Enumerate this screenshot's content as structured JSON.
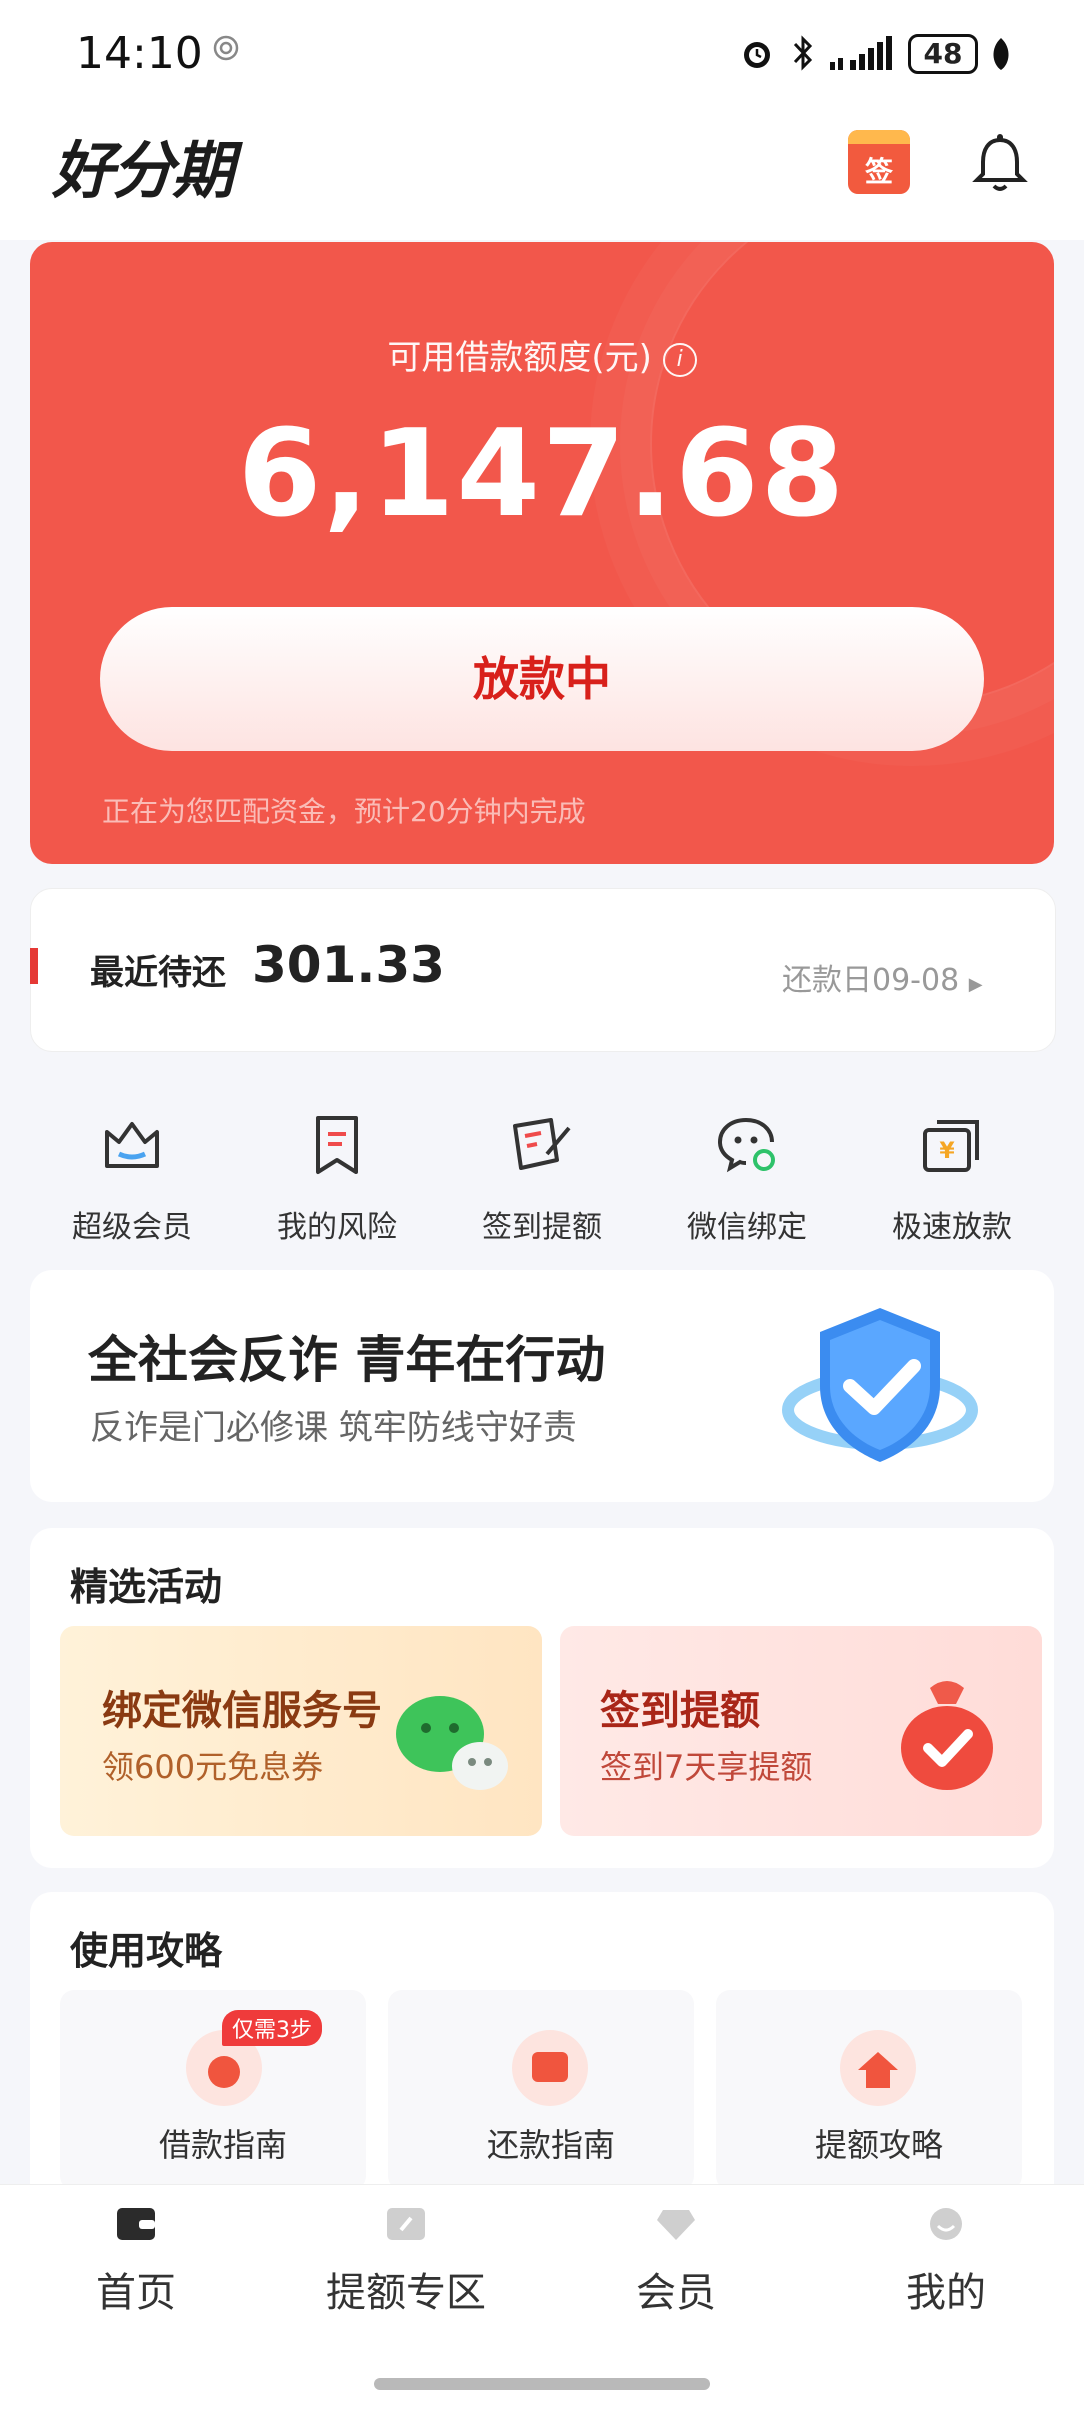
{
  "status_bar": {
    "time": "14:10",
    "battery": "48"
  },
  "header": {
    "logo": "好分期",
    "sign_icon_text": "签"
  },
  "credit": {
    "label": "可用借款额度(元)",
    "amount": "6,147.68",
    "status_button": "放款中",
    "note": "正在为您匹配资金，预计20分钟内完成"
  },
  "repay": {
    "label": "最近待还",
    "amount": "301.33",
    "date": "还款日09-08"
  },
  "quick_actions": [
    {
      "label": "超级会员",
      "icon": "crown-icon"
    },
    {
      "label": "我的风险",
      "icon": "bookmark-icon"
    },
    {
      "label": "签到提额",
      "icon": "sign-pen-icon"
    },
    {
      "label": "微信绑定",
      "icon": "wechat-icon"
    },
    {
      "label": "极速放款",
      "icon": "yuan-card-icon"
    }
  ],
  "fraud_banner": {
    "title": "全社会反诈 青年在行动",
    "subtitle": "反诈是门必修课 筑牢防线守好责"
  },
  "activities": {
    "title": "精选活动",
    "items": [
      {
        "title": "绑定微信服务号",
        "subtitle": "领600元免息券"
      },
      {
        "title": "签到提额",
        "subtitle": "签到7天享提额"
      }
    ]
  },
  "guide": {
    "title": "使用攻略",
    "badge": "仅需3步",
    "items": [
      {
        "label": "借款指南"
      },
      {
        "label": "还款指南"
      },
      {
        "label": "提额攻略"
      }
    ]
  },
  "nav": [
    {
      "label": "首页",
      "icon": "wallet-icon"
    },
    {
      "label": "提额专区",
      "icon": "arrow-card-icon"
    },
    {
      "label": "会员",
      "icon": "diamond-icon"
    },
    {
      "label": "我的",
      "icon": "face-icon"
    }
  ],
  "colors": {
    "brand_red": "#f2574b",
    "button_text": "#d8201b"
  }
}
